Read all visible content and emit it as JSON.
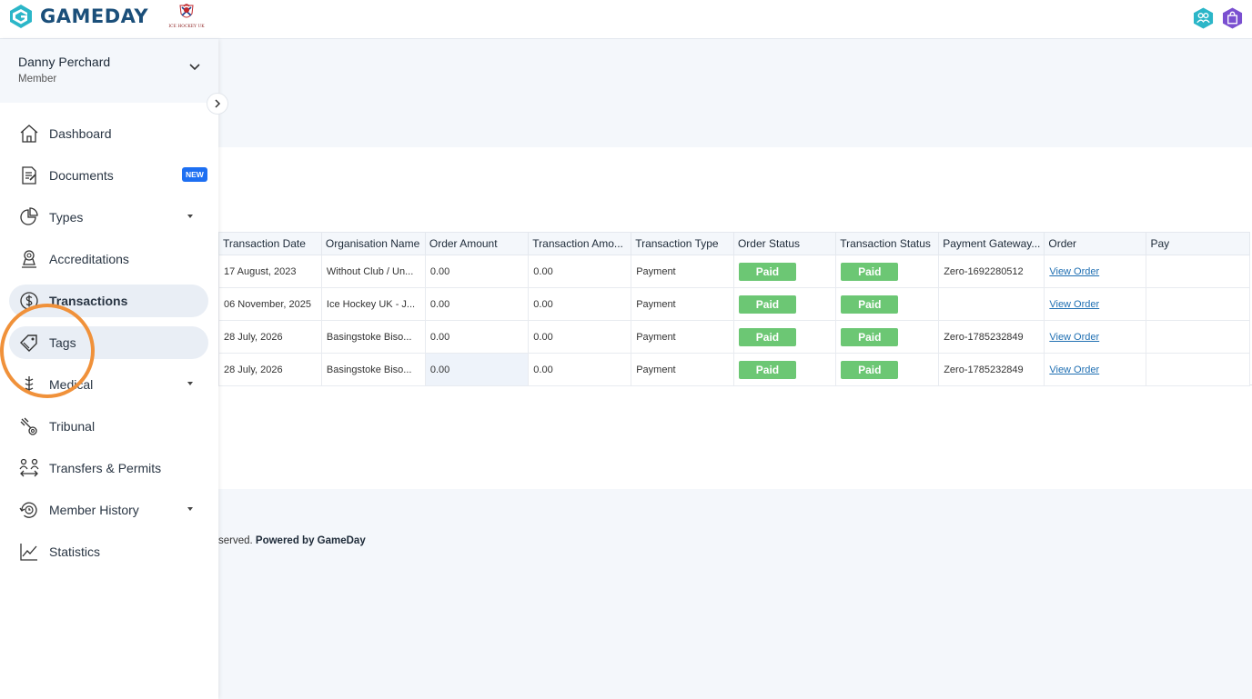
{
  "brand": {
    "name": "GAMEDAY",
    "org_logo_text": "ICE HOCKEY UK"
  },
  "colors": {
    "accent": "#1d6ff2",
    "status_paid": "#6cc774",
    "highlight_ring": "#f0913a",
    "brand": "#1b4f7a"
  },
  "user": {
    "name": "Danny Perchard",
    "role": "Member"
  },
  "nav": [
    {
      "label": "Dashboard",
      "icon": "home-icon"
    },
    {
      "label": "Documents",
      "icon": "document-icon",
      "badge": "NEW"
    },
    {
      "label": "Types",
      "icon": "pie-chart-icon",
      "has_caret": true
    },
    {
      "label": "Accreditations",
      "icon": "accreditation-icon"
    },
    {
      "label": "Transactions",
      "icon": "dollar-icon",
      "active": true
    },
    {
      "label": "Tags",
      "icon": "tag-icon",
      "hover": true
    },
    {
      "label": "Medical",
      "icon": "medical-icon",
      "has_caret": true
    },
    {
      "label": "Tribunal",
      "icon": "tribunal-icon"
    },
    {
      "label": "Transfers & Permits",
      "icon": "transfer-icon"
    },
    {
      "label": "Member History",
      "icon": "history-icon",
      "has_caret": true
    },
    {
      "label": "Statistics",
      "icon": "statistics-icon"
    }
  ],
  "table": {
    "columns": [
      "Transaction Date",
      "Organisation Name",
      "Order Amount",
      "Transaction Amo...",
      "Transaction Type",
      "Order Status",
      "Transaction Status",
      "Payment Gateway...",
      "Order",
      "Pay"
    ],
    "rows": [
      {
        "date": "17 August, 2023",
        "org": "Without Club / Un...",
        "order_amount": "0.00",
        "transaction_amount": "0.00",
        "type": "Payment",
        "order_status": "Paid",
        "transaction_status": "Paid",
        "gateway": "Zero-1692280512",
        "order": "View Order",
        "pay": ""
      },
      {
        "date": "06 November, 2025",
        "org": "Ice Hockey UK - J...",
        "order_amount": "0.00",
        "transaction_amount": "0.00",
        "type": "Payment",
        "order_status": "Paid",
        "transaction_status": "Paid",
        "gateway": "",
        "order": "View Order",
        "pay": ""
      },
      {
        "date": "28 July, 2026",
        "org": "Basingstoke Biso...",
        "order_amount": "0.00",
        "transaction_amount": "0.00",
        "type": "Payment",
        "order_status": "Paid",
        "transaction_status": "Paid",
        "gateway": "Zero-1785232849",
        "order": "View Order",
        "pay": ""
      },
      {
        "date": "28 July, 2026",
        "org": "Basingstoke Biso...",
        "order_amount": "0.00",
        "transaction_amount": "0.00",
        "type": "Payment",
        "order_status": "Paid",
        "transaction_status": "Paid",
        "gateway": "Zero-1785232849",
        "order": "View Order",
        "pay": ""
      }
    ]
  },
  "footer": {
    "text": "served.",
    "powered_by": "Powered by GameDay"
  }
}
